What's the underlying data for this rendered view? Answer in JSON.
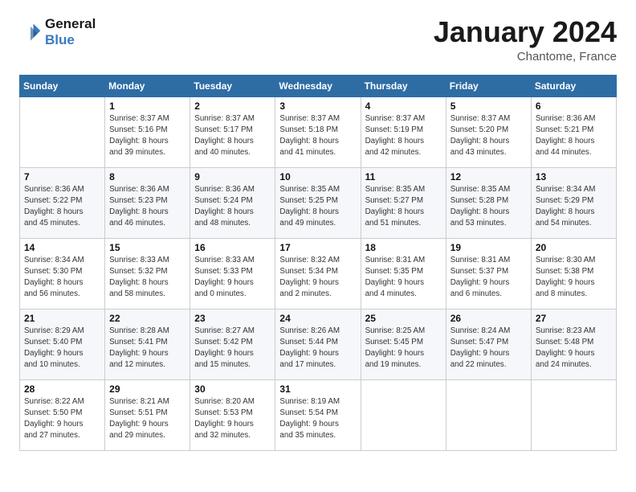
{
  "header": {
    "logo_line1": "General",
    "logo_line2": "Blue",
    "month": "January 2024",
    "location": "Chantome, France"
  },
  "days_of_week": [
    "Sunday",
    "Monday",
    "Tuesday",
    "Wednesday",
    "Thursday",
    "Friday",
    "Saturday"
  ],
  "weeks": [
    [
      {
        "day": "",
        "info": ""
      },
      {
        "day": "1",
        "info": "Sunrise: 8:37 AM\nSunset: 5:16 PM\nDaylight: 8 hours\nand 39 minutes."
      },
      {
        "day": "2",
        "info": "Sunrise: 8:37 AM\nSunset: 5:17 PM\nDaylight: 8 hours\nand 40 minutes."
      },
      {
        "day": "3",
        "info": "Sunrise: 8:37 AM\nSunset: 5:18 PM\nDaylight: 8 hours\nand 41 minutes."
      },
      {
        "day": "4",
        "info": "Sunrise: 8:37 AM\nSunset: 5:19 PM\nDaylight: 8 hours\nand 42 minutes."
      },
      {
        "day": "5",
        "info": "Sunrise: 8:37 AM\nSunset: 5:20 PM\nDaylight: 8 hours\nand 43 minutes."
      },
      {
        "day": "6",
        "info": "Sunrise: 8:36 AM\nSunset: 5:21 PM\nDaylight: 8 hours\nand 44 minutes."
      }
    ],
    [
      {
        "day": "7",
        "info": "Sunrise: 8:36 AM\nSunset: 5:22 PM\nDaylight: 8 hours\nand 45 minutes."
      },
      {
        "day": "8",
        "info": "Sunrise: 8:36 AM\nSunset: 5:23 PM\nDaylight: 8 hours\nand 46 minutes."
      },
      {
        "day": "9",
        "info": "Sunrise: 8:36 AM\nSunset: 5:24 PM\nDaylight: 8 hours\nand 48 minutes."
      },
      {
        "day": "10",
        "info": "Sunrise: 8:35 AM\nSunset: 5:25 PM\nDaylight: 8 hours\nand 49 minutes."
      },
      {
        "day": "11",
        "info": "Sunrise: 8:35 AM\nSunset: 5:27 PM\nDaylight: 8 hours\nand 51 minutes."
      },
      {
        "day": "12",
        "info": "Sunrise: 8:35 AM\nSunset: 5:28 PM\nDaylight: 8 hours\nand 53 minutes."
      },
      {
        "day": "13",
        "info": "Sunrise: 8:34 AM\nSunset: 5:29 PM\nDaylight: 8 hours\nand 54 minutes."
      }
    ],
    [
      {
        "day": "14",
        "info": "Sunrise: 8:34 AM\nSunset: 5:30 PM\nDaylight: 8 hours\nand 56 minutes."
      },
      {
        "day": "15",
        "info": "Sunrise: 8:33 AM\nSunset: 5:32 PM\nDaylight: 8 hours\nand 58 minutes."
      },
      {
        "day": "16",
        "info": "Sunrise: 8:33 AM\nSunset: 5:33 PM\nDaylight: 9 hours\nand 0 minutes."
      },
      {
        "day": "17",
        "info": "Sunrise: 8:32 AM\nSunset: 5:34 PM\nDaylight: 9 hours\nand 2 minutes."
      },
      {
        "day": "18",
        "info": "Sunrise: 8:31 AM\nSunset: 5:35 PM\nDaylight: 9 hours\nand 4 minutes."
      },
      {
        "day": "19",
        "info": "Sunrise: 8:31 AM\nSunset: 5:37 PM\nDaylight: 9 hours\nand 6 minutes."
      },
      {
        "day": "20",
        "info": "Sunrise: 8:30 AM\nSunset: 5:38 PM\nDaylight: 9 hours\nand 8 minutes."
      }
    ],
    [
      {
        "day": "21",
        "info": "Sunrise: 8:29 AM\nSunset: 5:40 PM\nDaylight: 9 hours\nand 10 minutes."
      },
      {
        "day": "22",
        "info": "Sunrise: 8:28 AM\nSunset: 5:41 PM\nDaylight: 9 hours\nand 12 minutes."
      },
      {
        "day": "23",
        "info": "Sunrise: 8:27 AM\nSunset: 5:42 PM\nDaylight: 9 hours\nand 15 minutes."
      },
      {
        "day": "24",
        "info": "Sunrise: 8:26 AM\nSunset: 5:44 PM\nDaylight: 9 hours\nand 17 minutes."
      },
      {
        "day": "25",
        "info": "Sunrise: 8:25 AM\nSunset: 5:45 PM\nDaylight: 9 hours\nand 19 minutes."
      },
      {
        "day": "26",
        "info": "Sunrise: 8:24 AM\nSunset: 5:47 PM\nDaylight: 9 hours\nand 22 minutes."
      },
      {
        "day": "27",
        "info": "Sunrise: 8:23 AM\nSunset: 5:48 PM\nDaylight: 9 hours\nand 24 minutes."
      }
    ],
    [
      {
        "day": "28",
        "info": "Sunrise: 8:22 AM\nSunset: 5:50 PM\nDaylight: 9 hours\nand 27 minutes."
      },
      {
        "day": "29",
        "info": "Sunrise: 8:21 AM\nSunset: 5:51 PM\nDaylight: 9 hours\nand 29 minutes."
      },
      {
        "day": "30",
        "info": "Sunrise: 8:20 AM\nSunset: 5:53 PM\nDaylight: 9 hours\nand 32 minutes."
      },
      {
        "day": "31",
        "info": "Sunrise: 8:19 AM\nSunset: 5:54 PM\nDaylight: 9 hours\nand 35 minutes."
      },
      {
        "day": "",
        "info": ""
      },
      {
        "day": "",
        "info": ""
      },
      {
        "day": "",
        "info": ""
      }
    ]
  ]
}
